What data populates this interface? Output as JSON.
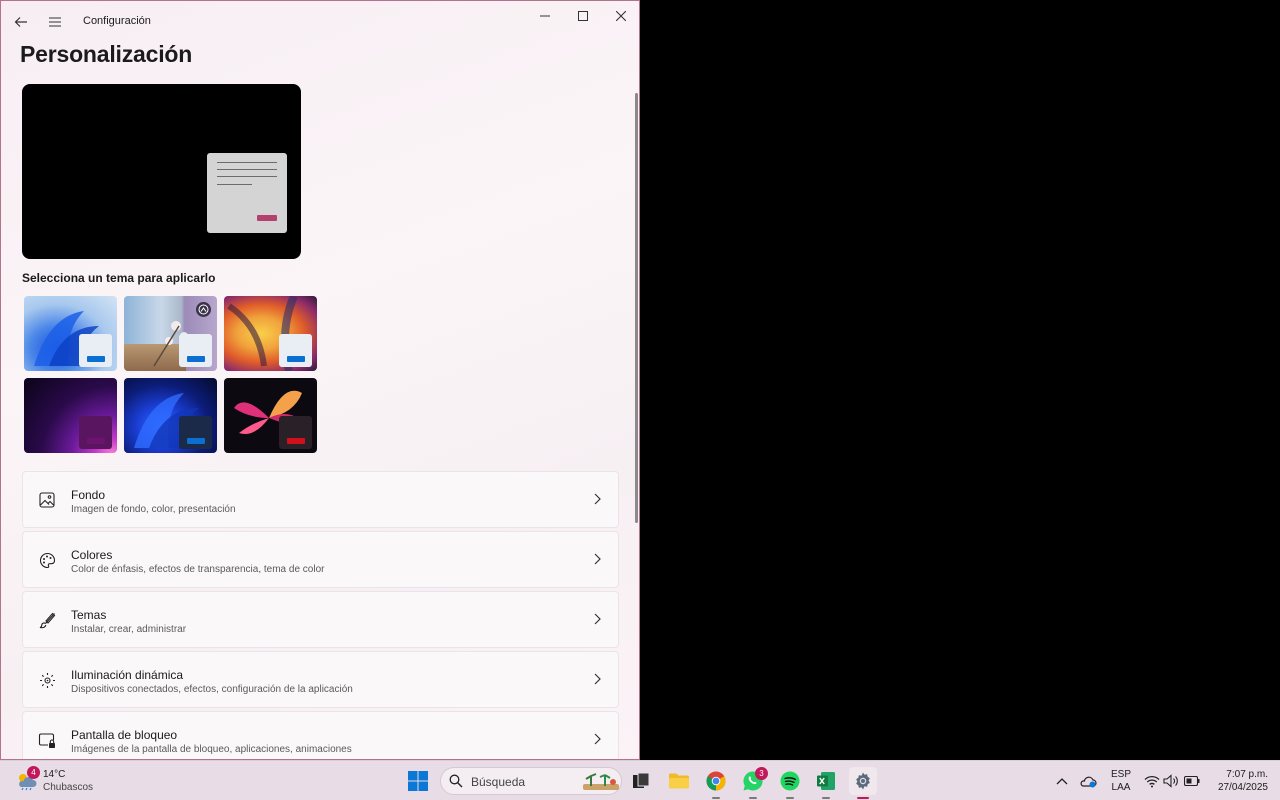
{
  "window": {
    "title": "Configuración",
    "page_title": "Personalización",
    "themes_label": "Selecciona un tema para aplicarlo"
  },
  "settings_rows": [
    {
      "title": "Fondo",
      "subtitle": "Imagen de fondo, color, presentación",
      "icon": "image-icon"
    },
    {
      "title": "Colores",
      "subtitle": "Color de énfasis, efectos de transparencia, tema de color",
      "icon": "palette-icon"
    },
    {
      "title": "Temas",
      "subtitle": "Instalar, crear, administrar",
      "icon": "brush-icon"
    },
    {
      "title": "Iluminación dinámica",
      "subtitle": "Dispositivos conectados, efectos, configuración de la aplicación",
      "icon": "lighting-icon"
    },
    {
      "title": "Pantalla de bloqueo",
      "subtitle": "Imágenes de la pantalla de bloqueo, aplicaciones, animaciones",
      "icon": "lock-screen-icon"
    }
  ],
  "themes": [
    {
      "name": "windows-light",
      "accent": "#0a6fd1"
    },
    {
      "name": "spotlight",
      "accent": "#0a6fd1"
    },
    {
      "name": "glow",
      "accent": "#0a6fd1"
    },
    {
      "name": "captured-motion",
      "accent": "#6a1470"
    },
    {
      "name": "windows-dark",
      "accent": "#0a6fd1"
    },
    {
      "name": "flow",
      "accent": "#d0101a"
    }
  ],
  "taskbar": {
    "weather_temp": "14°C",
    "weather_desc": "Chubascos",
    "weather_badge": "4",
    "search_placeholder": "Búsqueda",
    "whatsapp_badge": "3",
    "language_line1": "ESP",
    "language_line2": "LAA",
    "time": "7:07 p.m.",
    "date": "27/04/2025"
  },
  "colors": {
    "accent": "#b3406f",
    "window_border": "#b6718f"
  }
}
